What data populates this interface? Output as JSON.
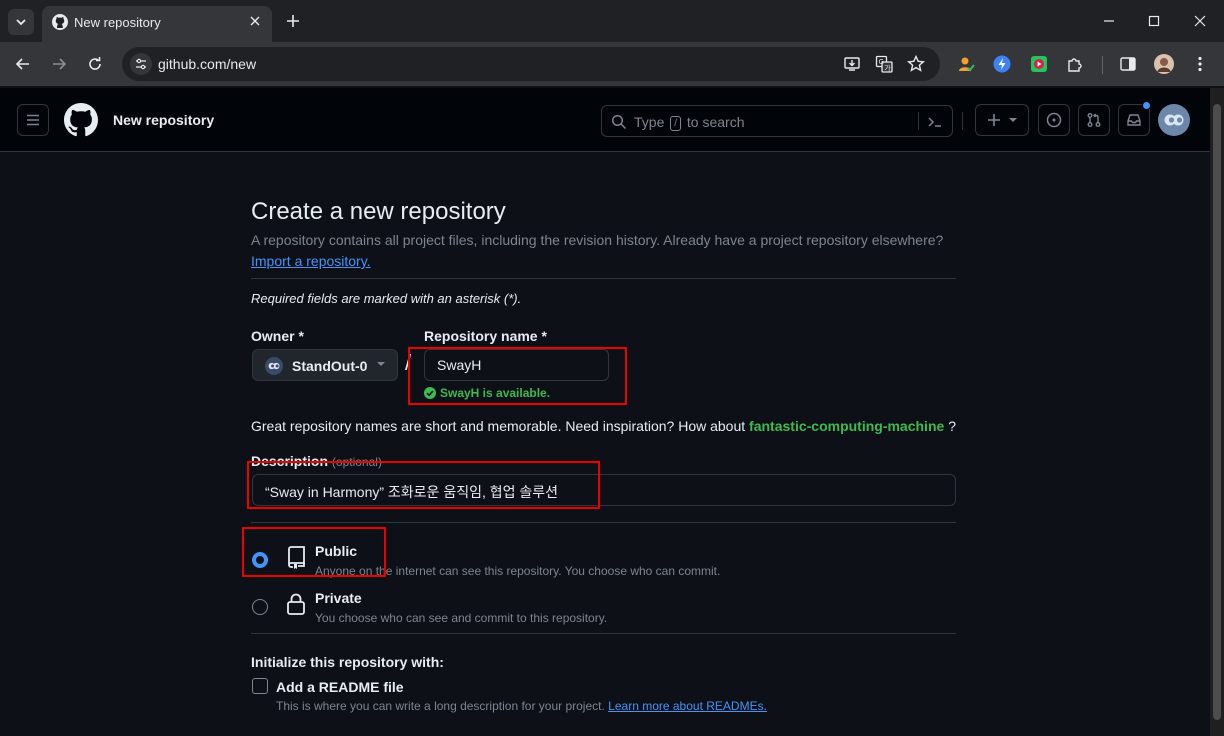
{
  "browser": {
    "tab_title": "New repository",
    "url": "github.com/new"
  },
  "header": {
    "context": "New repository",
    "search_before": "Type",
    "search_key": "/",
    "search_after": "to search"
  },
  "page": {
    "title": "Create a new repository",
    "subtitle": "A repository contains all project files, including the revision history. Already have a project repository elsewhere?",
    "import_link": "Import a repository.",
    "required_note": "Required fields are marked with an asterisk (*).",
    "owner_label": "Owner *",
    "owner_value": "StandOut-0",
    "repo_label": "Repository name *",
    "repo_value": "SwayH",
    "repo_status": "SwayH is available.",
    "separator": "/",
    "hint_text": "Great repository names are short and memorable. Need inspiration? How about",
    "hint_suggestion": "fantastic-computing-machine",
    "hint_end": "?",
    "description_label": "Description",
    "description_optional": "(optional)",
    "description_value": "“Sway in Harmony” 조화로운 움직임, 협업 솔루션",
    "visibility": [
      {
        "title": "Public",
        "desc": "Anyone on the internet can see this repository. You choose who can commit.",
        "selected": true
      },
      {
        "title": "Private",
        "desc": "You choose who can see and commit to this repository.",
        "selected": false
      }
    ],
    "init_label": "Initialize this repository with:",
    "readme_label": "Add a README file",
    "readme_desc": "This is where you can write a long description for your project.",
    "readme_link": "Learn more about READMEs."
  },
  "colors": {
    "background": "#0d1117",
    "header": "#010409",
    "accent": "#4493f8",
    "success": "#3fb950",
    "annotation": "#ee0000"
  }
}
